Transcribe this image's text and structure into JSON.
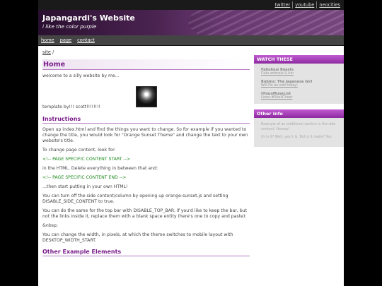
{
  "topbar": {
    "links": [
      "twitter",
      "youtube",
      "neocities"
    ]
  },
  "header": {
    "title": "Japangardi's Website",
    "tagline": "i like the color purple"
  },
  "nav": {
    "items": [
      "home",
      "page",
      "contact"
    ]
  },
  "breadcrumb": {
    "link": "site",
    "separator": "/"
  },
  "main": {
    "title": "Home",
    "welcome": "welcome to a silly website by me...",
    "credit": "template by!!! scott!!!!!!!!",
    "instructions_title": "Instructions",
    "instr_p1": "Open up index.html and find the things you want to change. So for example if you wanted to change the title, you would look for \"Orange Sunset Theme\" and change the text to your own website's title.",
    "instr_p2": "To change page content, look for:",
    "code_start": "<!-- PAGE SPECIFIC CONTENT START -->",
    "instr_p3": "in the HTML. Delete everything in between that and:",
    "code_end": "<!-- PAGE SPECIFIC CONTENT END -->",
    "instr_p4": "...then start putting in your own HTML!",
    "instr_p5": "You can turn off the side content/column by opening up orange-sunset.js and setting DISABLE_SIDE_CONTENT to true.",
    "instr_p6": "You can do the same for the top bar with DISABLE_TOP_BAR. If you'd like to keep the bar, but not the links inside it, replace them with a blank space entity (here's one to copy and paste):",
    "nbsp": "&nbsp;",
    "instr_p7": "You can change the width, in pixels, at which the theme switches to mobile layout with DESKTOP_WIDTH_START.",
    "other_title": "Other Example Elements"
  },
  "sidebar": {
    "watch_title": "WATCH THESE",
    "items": [
      {
        "title": "Fabulous Beasts",
        "sub": "Cute animals & fun"
      },
      {
        "title": "Robins: The Japanese Girl",
        "sub": "Will Fix an odd today!"
      },
      {
        "title": "UfuuuMuseList",
        "sub": "Lineo #ShellCheer"
      }
    ],
    "other_title": "Other Info",
    "text1": "Example of an additional section in the side content. Hooray!",
    "text2": "Or is it? Well, yes it is. But is it really? Yes."
  },
  "colors": {
    "accent": "#7a1d8a",
    "code": "#1e8a1e"
  }
}
